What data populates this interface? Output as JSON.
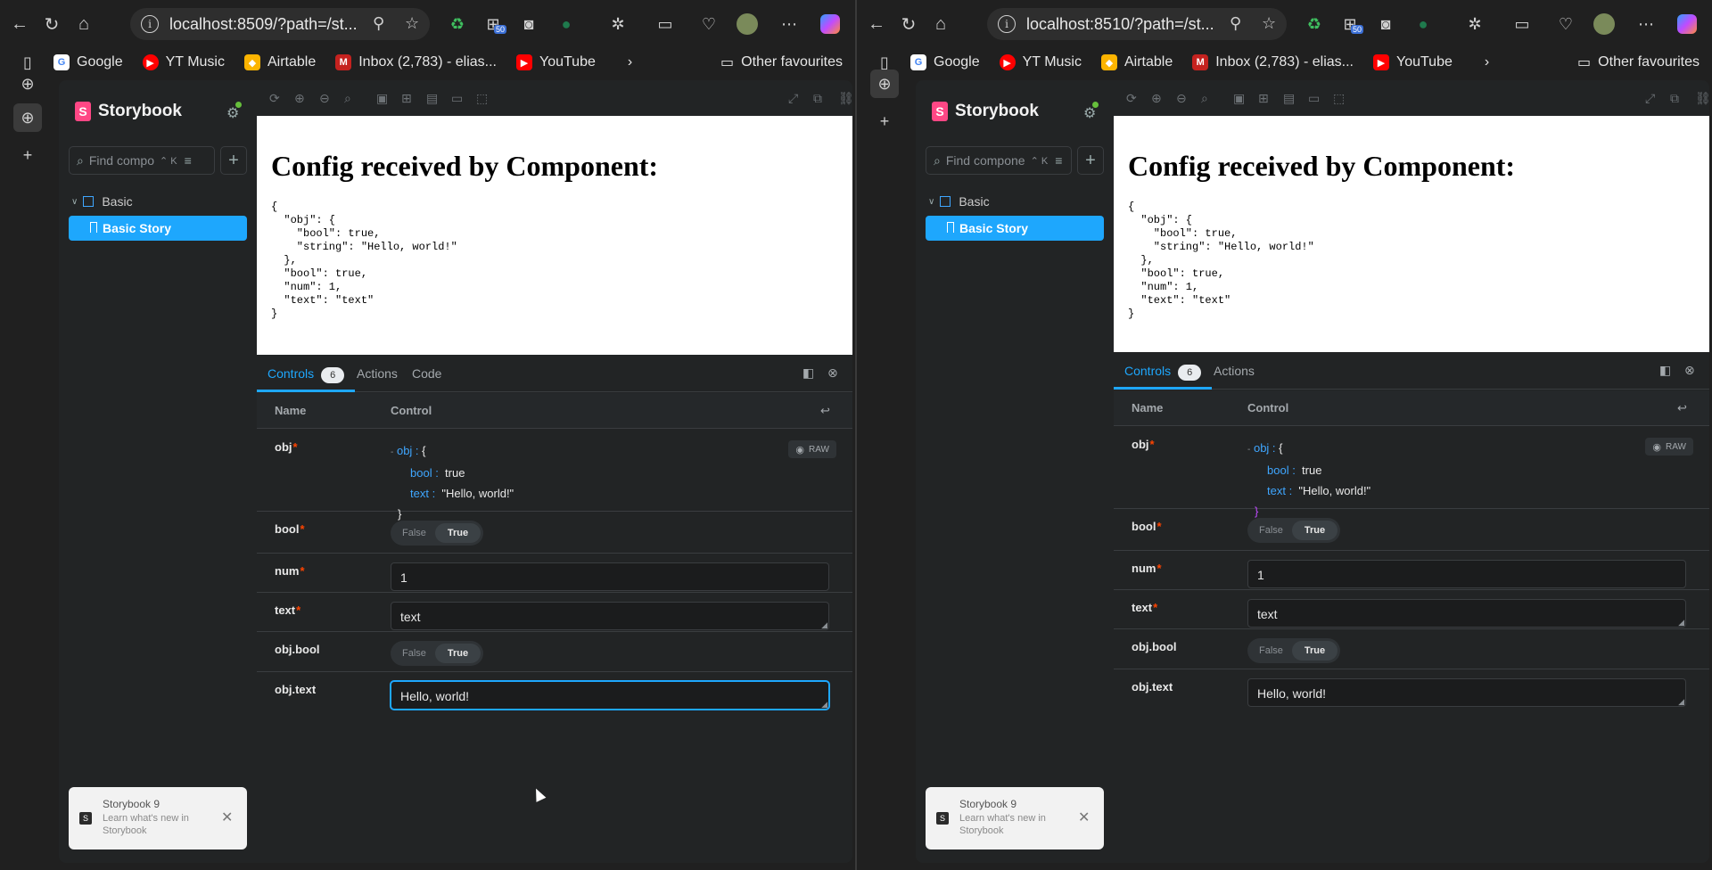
{
  "left_window": {
    "url": "localhost:8509/?path=/st...",
    "badge_count": "50",
    "tabs": [
      "Controls",
      "Actions",
      "Code"
    ],
    "controls_count": "6"
  },
  "right_window": {
    "url": "localhost:8510/?path=/st...",
    "badge_count": "50",
    "tabs": [
      "Controls",
      "Actions"
    ],
    "controls_count": "6"
  },
  "bookmarks": [
    "Google",
    "YT Music",
    "Airtable",
    "Inbox (2,783) - elias...",
    "YouTube"
  ],
  "other_favourites": "Other favourites",
  "storybook": {
    "brand": "Storybook",
    "search_placeholder": "Find compo",
    "search_placeholder_right": "Find compone",
    "search_shortcut": "⌃ K",
    "tree_group": "Basic",
    "story": "Basic Story",
    "notification_title": "Storybook 9",
    "notification_body": "Learn what's new in Storybook"
  },
  "preview": {
    "heading": "Config received by Component:",
    "json": "{\n  \"obj\": {\n    \"bool\": true,\n    \"string\": \"Hello, world!\"\n  },\n  \"bool\": true,\n  \"num\": 1,\n  \"text\": \"text\"\n}"
  },
  "controls": {
    "col_name": "Name",
    "col_control": "Control",
    "raw_label": "RAW",
    "obj_name": "obj",
    "obj_label": "obj :",
    "obj_open": "{",
    "obj_close": "}",
    "obj_bool_key": "bool :",
    "obj_bool_val": "true",
    "obj_text_key": "text :",
    "obj_text_val": "\"Hello, world!\"",
    "bool_name": "bool",
    "false_label": "False",
    "true_label": "True",
    "num_name": "num",
    "num_value": "1",
    "text_name": "text",
    "text_value": "text",
    "objbool_name": "obj.bool",
    "objtext_name": "obj.text",
    "objtext_value": "Hello, world!",
    "required_mark": "*"
  },
  "colors": {
    "accent": "#1ea7fd",
    "brand": "#ff4785",
    "required": "#ff4400"
  }
}
